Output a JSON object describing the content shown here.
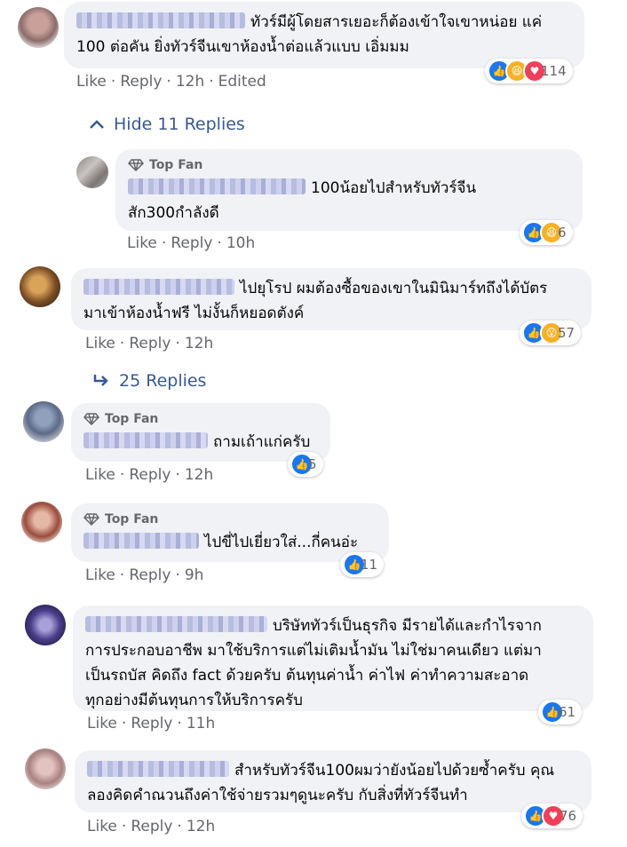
{
  "comments": [
    {
      "text": "ทัวร์มีผู้โดยสารเยอะก็ต้องเข้าใจเขาหน่อย แค่ 100 ต่อคัน ยิ่งทัวร์จีนเขาห้องน้ำต่อแล้วแบบ เอิ่มมม",
      "line1": "ทัวร์มีผู้โดยสารเยอะก็ต้องเข้าใจเขาหน่อย แค่",
      "line2": "100 ต่อคัน ยิ่งทัวร์จีนเขาห้องน้ำต่อแล้วแบบ เอิ่มมม",
      "like": "Like",
      "reply": "Reply",
      "time": "12h",
      "edited": "Edited",
      "reaction_count": "114"
    },
    {
      "badge": "Top Fan",
      "line1": "100น้อยไปสำหรับทัวร์จีน",
      "line2": "สัก300กำลังดี",
      "like": "Like",
      "reply": "Reply",
      "time": "10h",
      "reaction_count": "6"
    },
    {
      "line1": "ไปยุโรป ผมต้องซื้อของเขาในมินิมาร์ทถึงได้บัตร",
      "line2": "มาเข้าห้องน้ำฟรี ไม่งั้นก็หยอดตังค์",
      "like": "Like",
      "reply": "Reply",
      "time": "12h",
      "reaction_count": "57"
    },
    {
      "badge": "Top Fan",
      "line1": "ถามเถ้าแก่ครับ",
      "like": "Like",
      "reply": "Reply",
      "time": "12h",
      "reaction_count": "5"
    },
    {
      "badge": "Top Fan",
      "line1": "ไปขี่ไปเยี่ยวใส่...กี่คนอ่ะ",
      "like": "Like",
      "reply": "Reply",
      "time": "9h",
      "reaction_count": "11"
    },
    {
      "line1": "บริษัททัวร์เป็นธุรกิจ มีรายได้และกำไรจาก",
      "line2": "การประกอบอาชีพ มาใช้บริการแต่ไม่เติมน้ำมัน ไม่ใช่มาคนเดียว แต่มา",
      "line3": "เป็นรถบัส คิดถึง fact ด้วยครับ ต้นทุนค่าน้ำ ค่าไฟ ค่าทำความสะอาด",
      "line4": "ทุกอย่างมีต้นทุนการให้บริการครับ",
      "like": "Like",
      "reply": "Reply",
      "time": "11h",
      "reaction_count": "61"
    },
    {
      "line1": "สำหรับทัวร์จีน100ผมว่ายังน้อยไปด้วยซ้ำครับ คุณ",
      "line2": "ลองคิดคำณวนถึงค่าใช้จ่ายรวมๆดูนะครับ กับสิ่งที่ทัวร์จีนทำ",
      "like": "Like",
      "reply": "Reply",
      "time": "12h",
      "reaction_count": "76"
    }
  ],
  "hide_replies": "Hide 11 Replies",
  "view_replies": "25 Replies",
  "colors": {
    "link": "#385898",
    "like": "#1877f2",
    "love": "#f33e58",
    "haha": "#f7b125",
    "bubble": "#f0f2f5",
    "meta": "#65676b"
  },
  "icons": [
    "diamond-icon",
    "chevron-up-icon",
    "reply-arrow-icon",
    "like-reaction-icon",
    "haha-reaction-icon",
    "love-reaction-icon",
    "wow-reaction-icon"
  ]
}
